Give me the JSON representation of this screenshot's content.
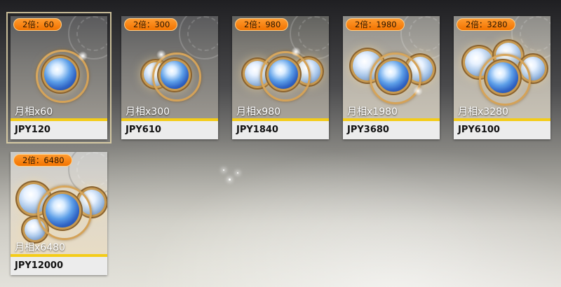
{
  "shop": {
    "products": [
      {
        "badge": "2倍：60",
        "name": "月相x60",
        "price": "JPY120"
      },
      {
        "badge": "2倍：300",
        "name": "月相x300",
        "price": "JPY610"
      },
      {
        "badge": "2倍：980",
        "name": "月相x980",
        "price": "JPY1840"
      },
      {
        "badge": "2倍：1980",
        "name": "月相x1980",
        "price": "JPY3680"
      },
      {
        "badge": "2倍：3280",
        "name": "月相x3280",
        "price": "JPY6100"
      },
      {
        "badge": "2倍：6480",
        "name": "月相x6480",
        "price": "JPY12000"
      }
    ],
    "colors": {
      "badge": "#f27300",
      "stripe": "#f4cc18",
      "price_bg": "#ececec"
    }
  }
}
